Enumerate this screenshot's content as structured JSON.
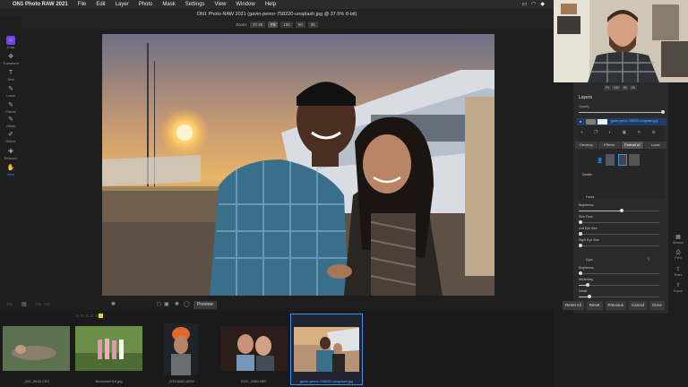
{
  "menubar": {
    "items": [
      "ON1 Photo RAW 2021",
      "File",
      "Edit",
      "Layer",
      "Photo",
      "Mask",
      "Settings",
      "View",
      "Window",
      "Help"
    ]
  },
  "window": {
    "title": "ON1 Photo RAW 2021 (gavin-penor-758220-unsplash.jpg @ 37.5% 8-bit)"
  },
  "zoom": {
    "label": "Zoom:",
    "value": "37.45",
    "buttons": [
      "Fit",
      "100",
      "50",
      "25"
    ]
  },
  "tools": [
    {
      "name": "crop",
      "label": "Crop",
      "icon": "crop-icon",
      "glyph": "⌗"
    },
    {
      "name": "transform",
      "label": "Transform",
      "icon": "transform-icon",
      "glyph": "✥"
    },
    {
      "name": "text",
      "label": "Text",
      "icon": "text-icon",
      "glyph": "T"
    },
    {
      "name": "local",
      "label": "Local",
      "icon": "brush-icon",
      "glyph": "✎"
    },
    {
      "name": "forms",
      "label": "Forms",
      "icon": "forms-icon",
      "glyph": "✎"
    },
    {
      "name": "mask",
      "label": "Mask",
      "icon": "mask-icon",
      "glyph": "✎"
    },
    {
      "name": "refine",
      "label": "Refine",
      "icon": "refine-icon",
      "glyph": "✐"
    },
    {
      "name": "retouch",
      "label": "Retouch",
      "icon": "retouch-icon",
      "glyph": "✚"
    },
    {
      "name": "view",
      "label": "View",
      "icon": "view-icon",
      "glyph": "✋"
    }
  ],
  "viewbar": {
    "preview_label": "Preview"
  },
  "filmstrip": [
    {
      "file": "_MG_9040.CR2"
    },
    {
      "file": "Buescher016.jpg"
    },
    {
      "file": "_DSC6160.ARW"
    },
    {
      "file": "DSC_0380.NEF"
    },
    {
      "file": "gavin-penor-758220-unsplash.jpg"
    }
  ],
  "right_panel": {
    "zoom_buttons": [
      "Fit",
      "100",
      "50",
      "25"
    ],
    "layers_title": "Layers",
    "opacity_label": "Opacity",
    "layer_name": "gavin-penor-758220-unsplash.jpg",
    "tabs": [
      "Develop",
      "Effects",
      "Portrait AI",
      "Local"
    ],
    "details_label": "Details",
    "face_section": "Faces",
    "face_controls": [
      "Brightness",
      "Skin Face",
      "Left Eye Size",
      "Right Eye Size"
    ],
    "eyes_section": "Eyes",
    "eyes_controls": [
      "Brightness",
      "Whitening",
      "Detail"
    ]
  },
  "bottom_buttons": [
    "Reset All",
    "Reset",
    "Previous",
    "Cancel",
    "Done"
  ],
  "right_tools": [
    {
      "label": "Browse",
      "icon": "browse-icon"
    },
    {
      "label": "Print",
      "icon": "print-icon"
    },
    {
      "label": "Share",
      "icon": "share-icon"
    },
    {
      "label": "Export",
      "icon": "export-icon"
    }
  ],
  "colors": {
    "accent": "#3a8ff0",
    "app_logo": "#7b3ff0",
    "selected_thumb_border": "#3a8ff0"
  }
}
